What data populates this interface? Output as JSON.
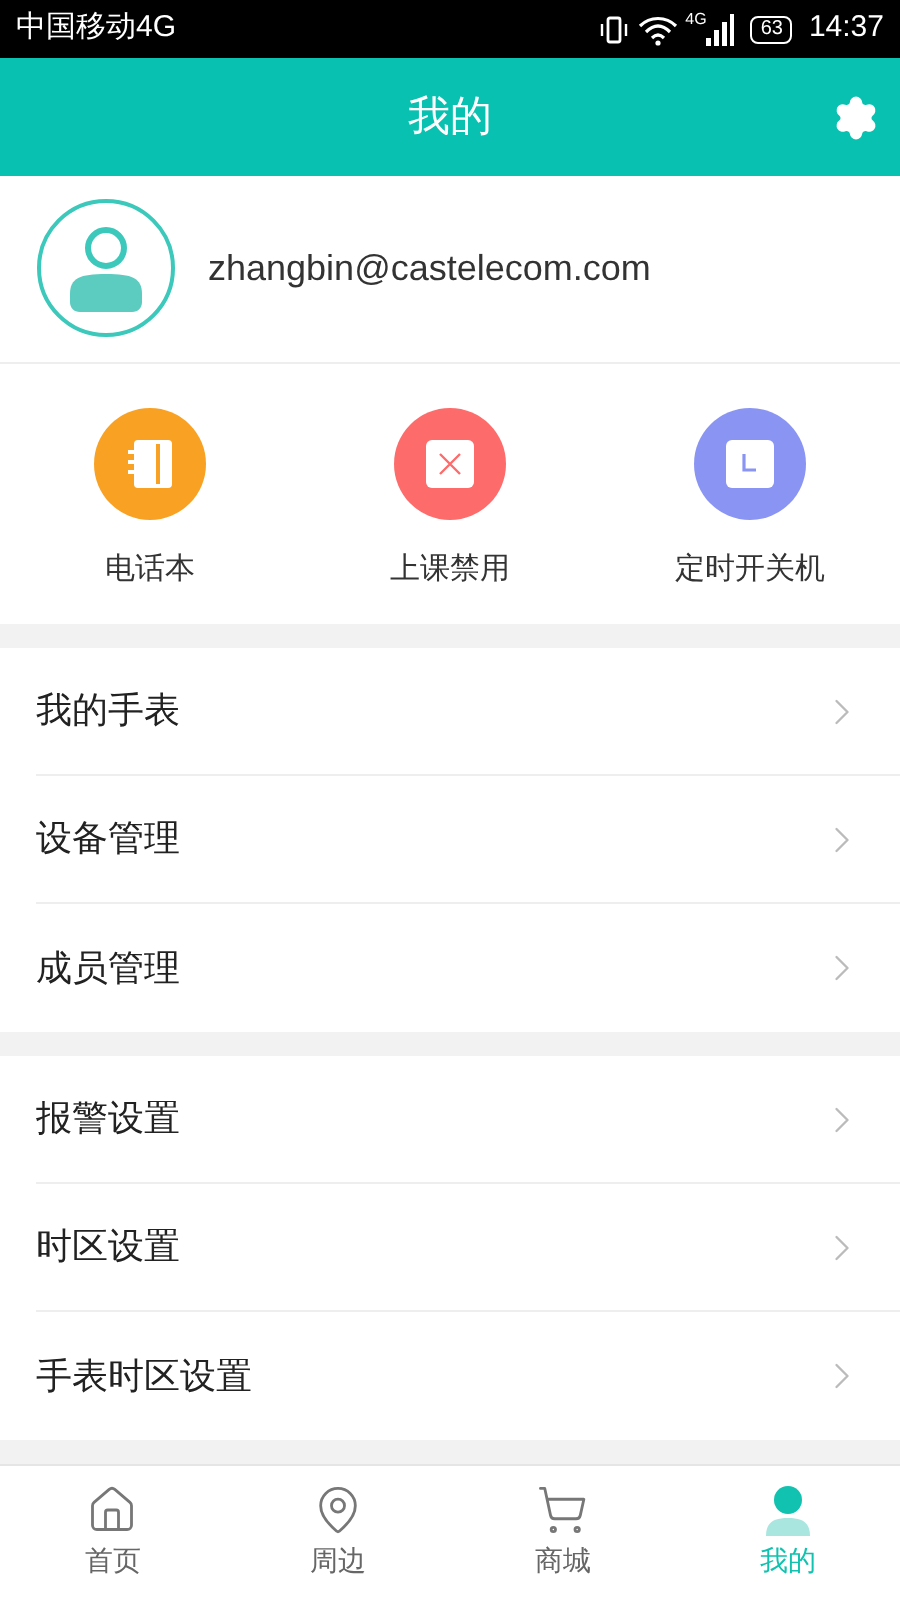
{
  "status_bar": {
    "carrier": "中国移动4G",
    "network": "4G",
    "battery": "63",
    "time": "14:37"
  },
  "header": {
    "title": "我的"
  },
  "profile": {
    "email": "zhangbin@castelecom.com"
  },
  "shortcuts": [
    {
      "kind": "phonebook",
      "label": "电话本",
      "color": "#f9a123"
    },
    {
      "kind": "class",
      "label": "上课禁用",
      "color": "#fd6b6b"
    },
    {
      "kind": "timer",
      "label": "定时开关机",
      "color": "#8a95f3"
    }
  ],
  "menu_groups": [
    [
      {
        "label": "我的手表"
      },
      {
        "label": "设备管理"
      },
      {
        "label": "成员管理"
      }
    ],
    [
      {
        "label": "报警设置"
      },
      {
        "label": "时区设置"
      },
      {
        "label": "手表时区设置"
      }
    ]
  ],
  "tabs": [
    {
      "kind": "home",
      "label": "首页",
      "selected": false
    },
    {
      "kind": "nearby",
      "label": "周边",
      "selected": false
    },
    {
      "kind": "shop",
      "label": "商城",
      "selected": false
    },
    {
      "kind": "me",
      "label": "我的",
      "selected": true
    }
  ]
}
